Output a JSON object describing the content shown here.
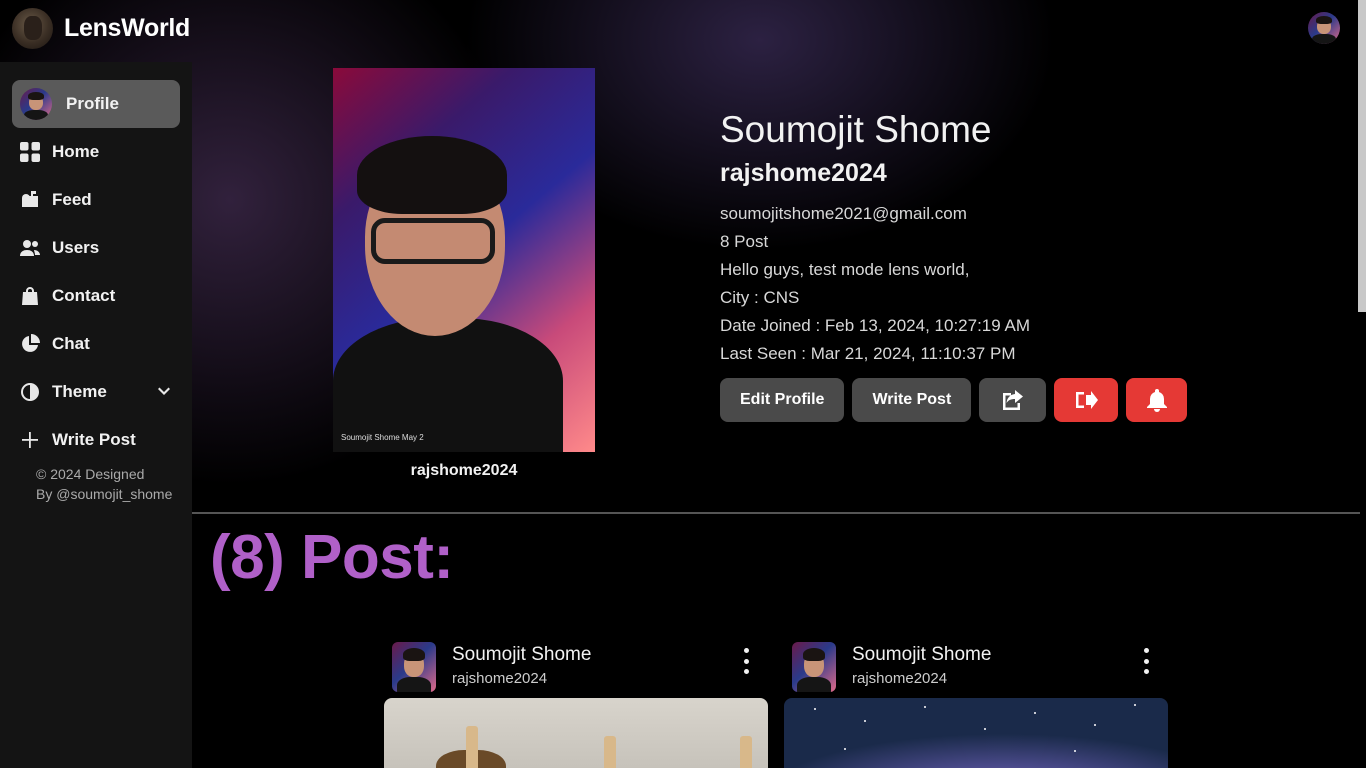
{
  "app": {
    "brand": "LensWorld"
  },
  "sidebar": {
    "items": [
      {
        "label": "Profile",
        "icon": "profile-avatar"
      },
      {
        "label": "Home",
        "icon": "grid-icon"
      },
      {
        "label": "Feed",
        "icon": "mailbox-icon"
      },
      {
        "label": "Users",
        "icon": "users-icon"
      },
      {
        "label": "Contact",
        "icon": "bag-icon"
      },
      {
        "label": "Chat",
        "icon": "pie-chart-icon"
      },
      {
        "label": "Theme",
        "icon": "half-circle-icon"
      },
      {
        "label": "Write Post",
        "icon": "plus-icon"
      }
    ],
    "footer_line1": "© 2024 Designed",
    "footer_line2": "By @soumojit_shome"
  },
  "profile": {
    "photo_caption": "rajshome2024",
    "photo_watermark": "Soumojit Shome  May 2",
    "full_name": "Soumojit Shome",
    "username": "rajshome2024",
    "email": "soumojitshome2021@gmail.com",
    "post_count": "8 Post",
    "bio": "Hello guys, test mode lens world,",
    "city": "City : CNS",
    "date_joined": "Date Joined : Feb 13, 2024, 10:27:19 AM",
    "last_seen": "Last Seen : Mar 21, 2024, 11:10:37 PM"
  },
  "actions": {
    "edit_profile": "Edit Profile",
    "write_post": "Write Post",
    "share_icon": "share-icon",
    "logout_icon": "logout-icon",
    "bell_icon": "bell-icon"
  },
  "posts_section": {
    "heading": "(8) Post:",
    "posts": [
      {
        "name": "Soumojit Shome",
        "username": "rajshome2024"
      },
      {
        "name": "Soumojit Shome",
        "username": "rajshome2024"
      }
    ]
  },
  "colors": {
    "accent_purple": "#b060c8",
    "danger_red": "#e53935",
    "active_nav": "#5a5a5a"
  }
}
